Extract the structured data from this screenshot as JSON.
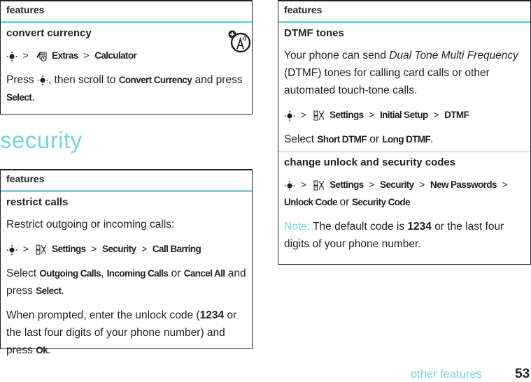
{
  "table1": {
    "header": "features",
    "title": "convert currency",
    "path": [
      "Extras",
      "Calculator"
    ],
    "path_icon": "extras-icon",
    "instruction": {
      "prefix": "Press",
      "middle": ", then scroll to",
      "item": "Convert Currency",
      "suffix": "and press",
      "key": "Select",
      "end": "."
    },
    "badge_icon": "network-dependent-feature-icon"
  },
  "section": {
    "title": "security"
  },
  "table2": {
    "header": "features",
    "title": "restrict calls",
    "intro": "Restrict outgoing or incoming calls:",
    "path": [
      "Settings",
      "Security",
      "Call Barring"
    ],
    "path_icon": "settings-icon",
    "select": {
      "prefix": "Select",
      "opt1": "Outgoing Calls",
      "sep1": ",",
      "opt2": "Incoming Calls",
      "or": "or",
      "opt3": "Cancel All",
      "suffix": "and press",
      "key": "Select",
      "end": "."
    },
    "prompt": {
      "prefix": "When prompted, enter the unlock code (",
      "code": "1234",
      "middle": "or the last four digits of your phone number) and press",
      "key": "Ok",
      "end": "."
    }
  },
  "table3": {
    "header": "features",
    "rows": [
      {
        "title": "DTMF tones",
        "desc_prefix": "Your phone can send",
        "desc_italic": "Dual Tone Multi Frequency",
        "desc_suffix": "(DTMF) tones for calling card calls or other automated touch-tone calls.",
        "path": [
          "Settings",
          "Initial Setup",
          "DTMF"
        ],
        "path_icon": "settings-icon",
        "select_prefix": "Select",
        "opt1": "Short DTMF",
        "or": "or",
        "opt2": "Long DTMF",
        "end": "."
      },
      {
        "title": "change unlock and security codes",
        "path": [
          "Settings",
          "Security",
          "New Passwords",
          "Unlock Code"
        ],
        "path_or": "or",
        "path_last": "Security Code",
        "path_icon": "settings-icon",
        "note_label": "Note:",
        "note_prefix": "The default code is",
        "note_code": "1234",
        "note_suffix": "or the last four digits of your phone number."
      }
    ]
  },
  "footer": {
    "label": "other features",
    "page": "53"
  },
  "symbols": {
    "gt": ">"
  },
  "colors": {
    "accent": "#7dd3d8",
    "text": "#231f20"
  }
}
